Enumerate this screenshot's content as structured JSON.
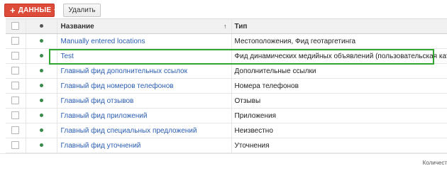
{
  "toolbar": {
    "data_button_plus": "+",
    "data_button_label": "ДАННЫЕ",
    "delete_button_label": "Удалить"
  },
  "table": {
    "columns": {
      "name": "Название",
      "type": "Тип",
      "name_sort_indicator": "↑"
    },
    "rows": [
      {
        "name": "Manually entered locations",
        "type": "Местоположения, Фид геотаргетинга"
      },
      {
        "name": "Test",
        "type": "Фид динамических медийных объявлений (пользовательская категория)"
      },
      {
        "name": "Главный фид дополнительных ссылок",
        "type": "Дополнительные ссылки"
      },
      {
        "name": "Главный фид номеров телефонов",
        "type": "Номера телефонов"
      },
      {
        "name": "Главный фид отзывов",
        "type": "Отзывы"
      },
      {
        "name": "Главный фид приложений",
        "type": "Приложения"
      },
      {
        "name": "Главный фид специальных предложений",
        "type": "Неизвестно"
      },
      {
        "name": "Главный фид уточнений",
        "type": "Уточнения"
      }
    ],
    "highlighted_row_index": 1
  },
  "footer": {
    "text": "Количест"
  },
  "colors": {
    "primary_button": "#dd4b39",
    "link": "#2a5db0",
    "status_dot": "#3a8a4c",
    "highlight_border": "#33a532"
  }
}
